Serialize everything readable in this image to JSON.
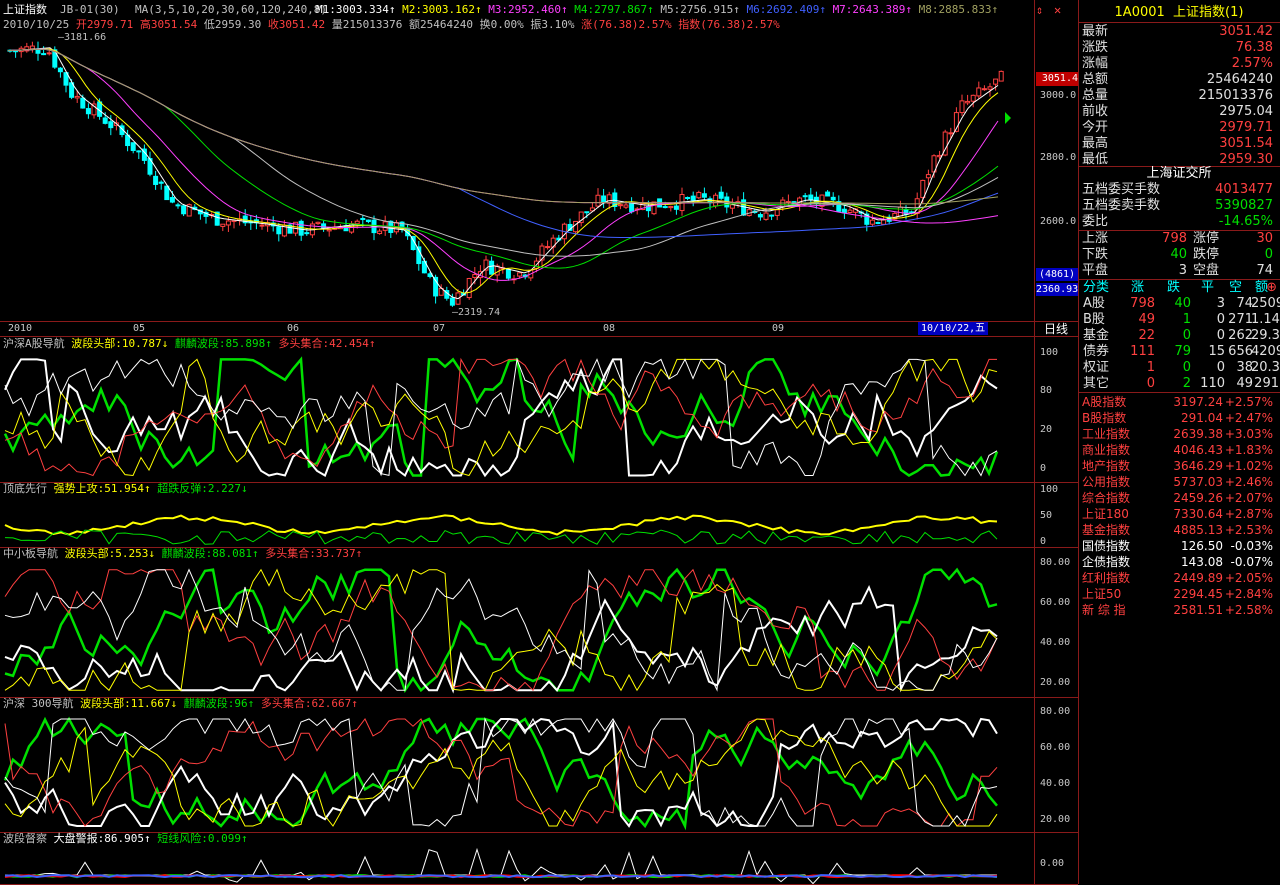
{
  "header": {
    "title": "上证指数",
    "indicator": "JB-01(30)",
    "ma_params": "MA(3,5,10,20,30,60,120,240,8)",
    "ma": [
      {
        "label": "M1:3003.334",
        "color": "#ffffff"
      },
      {
        "label": "M2:3003.162",
        "color": "#ffff00"
      },
      {
        "label": "M3:2952.460",
        "color": "#ff40ff"
      },
      {
        "label": "M4:2797.867",
        "color": "#00e000"
      },
      {
        "label": "M5:2756.915",
        "color": "#c0c0c0"
      },
      {
        "label": "M6:2692.409",
        "color": "#4060ff"
      },
      {
        "label": "M7:2643.389",
        "color": "#ff40ff"
      },
      {
        "label": "M8:2885.833",
        "color": "#a0a060"
      }
    ],
    "date": "2010/10/25",
    "open": "开2979.71",
    "high": "高3051.54",
    "low": "低2959.30",
    "close": "收3051.42",
    "volume": "量215013376",
    "amount": "额25464240",
    "turnover": "换0.00%",
    "amplitude": "振3.10%",
    "change": "涨(76.38)2.57%",
    "index_change": "指数(76.38)2.57%"
  },
  "main_chart": {
    "y_ticks": [
      "3000.0",
      "2800.0",
      "2600.0"
    ],
    "price_tag": "3051.4",
    "min_label": "2319.74",
    "max_label": "3181.66",
    "count_tag": "(4861)",
    "bottom_tag": "2360.93",
    "x_labels": [
      "2010",
      "05",
      "06",
      "07",
      "08",
      "09"
    ],
    "date_tag": "10/10/22,五",
    "period": "日线"
  },
  "panels": [
    {
      "name": "沪深A股导航",
      "items": [
        {
          "t": "波段头部:10.787↓",
          "c": "#ffff00"
        },
        {
          "t": "麒麟波段:85.898↑",
          "c": "#00e000"
        },
        {
          "t": "多头集合:42.454↑",
          "c": "#ff4040"
        }
      ],
      "ticks": [
        "100",
        "80",
        "20",
        "0"
      ]
    },
    {
      "name": "顶底先行",
      "items": [
        {
          "t": "强势上攻:51.954↑",
          "c": "#ffff00"
        },
        {
          "t": "超跌反弹:2.227↓",
          "c": "#00e000"
        }
      ],
      "ticks": [
        "100",
        "50",
        "0"
      ]
    },
    {
      "name": "中小板导航",
      "items": [
        {
          "t": "波段头部:5.253↓",
          "c": "#ffff00"
        },
        {
          "t": "麒麟波段:88.081↑",
          "c": "#00e000"
        },
        {
          "t": "多头集合:33.737↑",
          "c": "#ff4040"
        }
      ],
      "ticks": [
        "80.00",
        "60.00",
        "40.00",
        "20.00"
      ]
    },
    {
      "name": "沪深 300导航",
      "items": [
        {
          "t": "波段头部:11.667↓",
          "c": "#ffff00"
        },
        {
          "t": "麒麟波段:96↑",
          "c": "#00e000"
        },
        {
          "t": "多头集合:62.667↑",
          "c": "#ff4040"
        }
      ],
      "ticks": [
        "80.00",
        "60.00",
        "40.00",
        "20.00"
      ]
    },
    {
      "name": "波段督察",
      "items": [
        {
          "t": "大盘警报:86.905↑",
          "c": "#ffffff"
        },
        {
          "t": "短线风险:0.099↑",
          "c": "#00e000"
        }
      ],
      "ticks": [
        "0.00"
      ]
    }
  ],
  "quote": {
    "code": "1A0001",
    "name": "上证指数(1)",
    "rows": [
      {
        "k": "最新",
        "v": "3051.42"
      },
      {
        "k": "涨跌",
        "v": "76.38"
      },
      {
        "k": "涨幅",
        "v": "2.57%"
      },
      {
        "k": "总额",
        "v": "25464240",
        "w": true
      },
      {
        "k": "总量",
        "v": "215013376",
        "w": true
      },
      {
        "k": "前收",
        "v": "2975.04",
        "w": true
      },
      {
        "k": "今开",
        "v": "2979.71"
      },
      {
        "k": "最高",
        "v": "3051.54"
      },
      {
        "k": "最低",
        "v": "2959.30"
      }
    ],
    "exchange": "上海证交所",
    "book": [
      {
        "k": "五档委买手数",
        "v": "4013477"
      },
      {
        "k": "五档委卖手数",
        "v": "5390827"
      },
      {
        "k": "委比",
        "v": "-14.65%"
      }
    ],
    "breadth": [
      {
        "a": "上涨",
        "b": "798",
        "c": "涨停",
        "d": "30"
      },
      {
        "a": "下跌",
        "b": "40",
        "c": "跌停",
        "d": "0"
      },
      {
        "a": "平盘",
        "b": "3",
        "c": "空盘",
        "d": "74"
      }
    ],
    "cat_header": [
      "分类",
      "涨",
      "跌",
      "平",
      "空",
      "额"
    ],
    "cats": [
      [
        "A股",
        "798",
        "40",
        "3",
        "74",
        "2509"
      ],
      [
        "B股",
        "49",
        "1",
        "0",
        "271",
        "1.14"
      ],
      [
        "基金",
        "22",
        "0",
        "0",
        "262",
        "29.3"
      ],
      [
        "债券",
        "111",
        "79",
        "15",
        "656",
        "4209"
      ],
      [
        "权证",
        "1",
        "0",
        "0",
        "38",
        "20.3"
      ],
      [
        "其它",
        "0",
        "2",
        "110",
        "49",
        "291"
      ]
    ],
    "indices": [
      {
        "n": "A股指数",
        "p": "3197.24",
        "c": "+2.57%",
        "col": "red"
      },
      {
        "n": "B股指数",
        "p": "291.04",
        "c": "+2.47%",
        "col": "red"
      },
      {
        "n": "工业指数",
        "p": "2639.38",
        "c": "+3.03%",
        "col": "red"
      },
      {
        "n": "商业指数",
        "p": "4046.43",
        "c": "+1.83%",
        "col": "red"
      },
      {
        "n": "地产指数",
        "p": "3646.29",
        "c": "+1.02%",
        "col": "red"
      },
      {
        "n": "公用指数",
        "p": "5737.03",
        "c": "+2.46%",
        "col": "red"
      },
      {
        "n": "综合指数",
        "p": "2459.26",
        "c": "+2.07%",
        "col": "red"
      },
      {
        "n": "上证180",
        "p": "7330.64",
        "c": "+2.87%",
        "col": "red"
      },
      {
        "n": "基金指数",
        "p": "4885.13",
        "c": "+2.53%",
        "col": "red"
      },
      {
        "n": "国债指数",
        "p": "126.50",
        "c": "-0.03%",
        "col": "green"
      },
      {
        "n": "企债指数",
        "p": "143.08",
        "c": "-0.07%",
        "col": "green"
      },
      {
        "n": "红利指数",
        "p": "2449.89",
        "c": "+2.05%",
        "col": "red"
      },
      {
        "n": "上证50",
        "p": "2294.45",
        "c": "+2.84%",
        "col": "red"
      },
      {
        "n": "新 综 指",
        "p": "2581.51",
        "c": "+2.58%",
        "col": "red"
      }
    ]
  }
}
